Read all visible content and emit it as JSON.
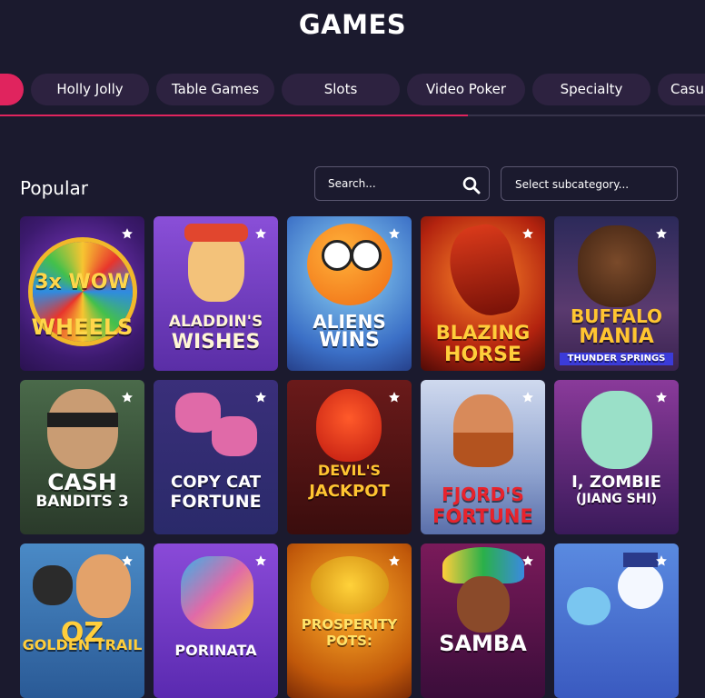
{
  "page": {
    "title": "GAMES"
  },
  "tabs": [
    {
      "label": "",
      "active": true
    },
    {
      "label": "Holly Jolly"
    },
    {
      "label": "Table Games"
    },
    {
      "label": "Slots"
    },
    {
      "label": "Video Poker"
    },
    {
      "label": "Specialty"
    },
    {
      "label": "Casual"
    }
  ],
  "section": {
    "title": "Popular"
  },
  "search": {
    "placeholder": "Search..."
  },
  "subcategory": {
    "placeholder": "Select subcategory..."
  },
  "games": [
    {
      "title": "3x WOW WHEELS",
      "line1": "3x WOW",
      "line2": "WHEELS"
    },
    {
      "title": "ALADDIN'S WISHES",
      "line1": "ALADDIN'S",
      "line2": "WISHES"
    },
    {
      "title": "ALIENS WINS",
      "line1": "ALIENS",
      "line2": "WINS"
    },
    {
      "title": "BLAZING HORSE",
      "line1": "BLAZING",
      "line2": "HORSE"
    },
    {
      "title": "BUFFALO MANIA THUNDER SPRINGS",
      "line1": "BUFFALO",
      "line2": "MANIA",
      "line3": "THUNDER SPRINGS"
    },
    {
      "title": "CASH BANDITS 3",
      "line1": "CASH",
      "line2": "BANDITS 3"
    },
    {
      "title": "COPY CAT FORTUNE",
      "line1": "COPY CAT",
      "line2": "FORTUNE"
    },
    {
      "title": "DEVIL'S JACKPOT",
      "line1": "DEVIL'S",
      "line2": "JACKPOT"
    },
    {
      "title": "FJORD'S FORTUNE",
      "line1": "FJORD'S",
      "line2": "FORTUNE"
    },
    {
      "title": "I, ZOMBIE (JIANG SHI)",
      "line1": "I, ZOMBIE",
      "line2": "(JIANG SHI)"
    },
    {
      "title": "OZ GOLDEN TRAIL",
      "line1": "OZ",
      "line2": "GOLDEN TRAIL"
    },
    {
      "title": "PORINATA",
      "line1": "",
      "line2": "PORINATA"
    },
    {
      "title": "PROSPERITY POTS",
      "line1": "PROSPERITY",
      "line2": "POTS:"
    },
    {
      "title": "SAMBA",
      "line1": "",
      "line2": "SAMBA"
    },
    {
      "title": "",
      "line1": "",
      "line2": ""
    }
  ],
  "colors": {
    "background": "#1b1a2e",
    "tab": "#2d2240",
    "accent": "#e0245e"
  },
  "icons": {
    "favorite": "star-icon",
    "search": "search-icon"
  }
}
